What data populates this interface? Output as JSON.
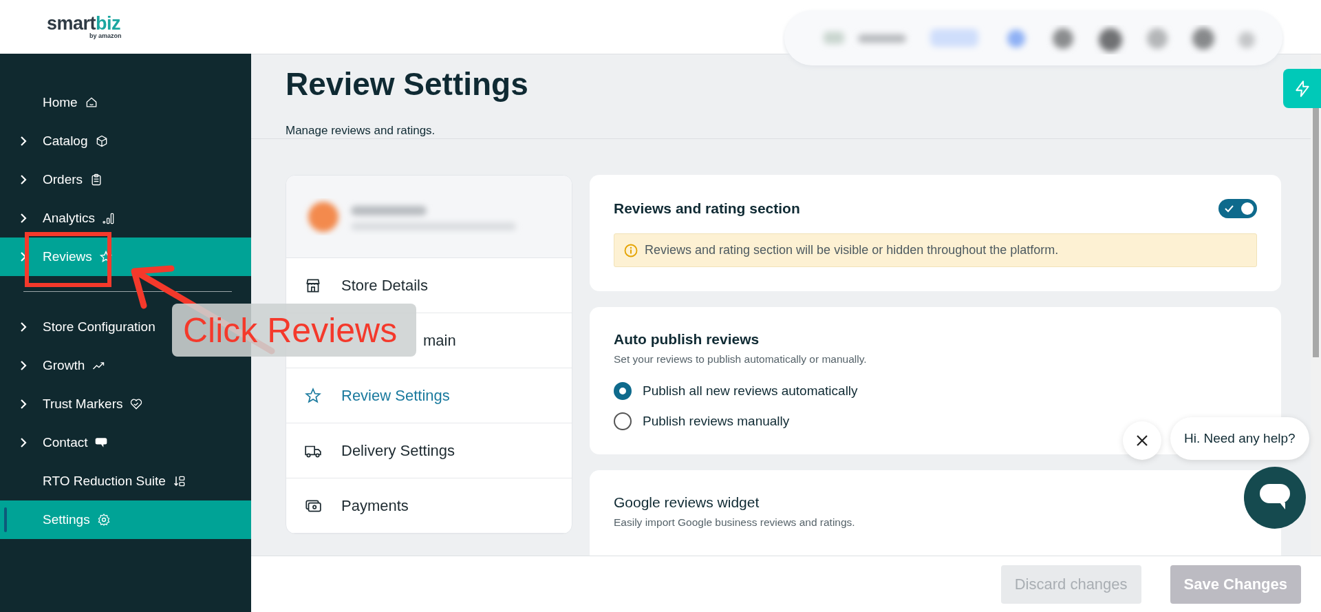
{
  "logo": {
    "name_dark": "smart",
    "name_accent": "biz",
    "tagline": "by amazon"
  },
  "sidebar": {
    "items": [
      {
        "label": "Home",
        "expandable": false,
        "highlighted": false,
        "selected": false
      },
      {
        "label": "Catalog",
        "expandable": true,
        "highlighted": false,
        "selected": false
      },
      {
        "label": "Orders",
        "expandable": true,
        "highlighted": false,
        "selected": false
      },
      {
        "label": "Analytics",
        "expandable": true,
        "highlighted": false,
        "selected": false
      },
      {
        "label": "Reviews",
        "expandable": true,
        "highlighted": true,
        "selected": false
      },
      {
        "kind": "divider"
      },
      {
        "label": "Store Configuration",
        "expandable": true,
        "highlighted": false,
        "selected": false
      },
      {
        "label": "Growth",
        "expandable": true,
        "highlighted": false,
        "selected": false
      },
      {
        "label": "Trust Markers",
        "expandable": true,
        "highlighted": false,
        "selected": false
      },
      {
        "label": "Contact",
        "expandable": true,
        "highlighted": false,
        "selected": false
      },
      {
        "label": "RTO Reduction Suite",
        "expandable": false,
        "highlighted": false,
        "selected": false
      },
      {
        "label": "Settings",
        "expandable": false,
        "highlighted": false,
        "selected": true
      }
    ]
  },
  "page": {
    "title": "Review Settings",
    "subtitle": "Manage reviews and ratings."
  },
  "settings_nav": {
    "items": [
      {
        "label": "Store Details",
        "selected": false
      },
      {
        "label": "main",
        "selected": false,
        "kind": "covered"
      },
      {
        "label": "Review Settings",
        "selected": true
      },
      {
        "label": "Delivery Settings",
        "selected": false
      },
      {
        "label": "Payments",
        "selected": false
      }
    ]
  },
  "cards": [
    {
      "kind": "toggle",
      "title": "Reviews and rating section",
      "on": true,
      "notice": "Reviews and rating section will be visible or hidden throughout the platform."
    },
    {
      "kind": "radio",
      "title": "Auto publish reviews",
      "description": "Set your reviews to publish automatically or manually.",
      "options": [
        {
          "label": "Publish all new reviews automatically",
          "selected": true
        },
        {
          "label": "Publish reviews manually",
          "selected": false
        }
      ]
    },
    {
      "kind": "plain",
      "title": "Google reviews widget",
      "description": "Easily import Google business reviews and ratings."
    }
  ],
  "footer": {
    "buttons": [
      "Discard changes",
      "Save Changes"
    ]
  },
  "chat": {
    "greeting": "Hi. Need any help?"
  },
  "annotation": {
    "text": "Click Reviews"
  }
}
